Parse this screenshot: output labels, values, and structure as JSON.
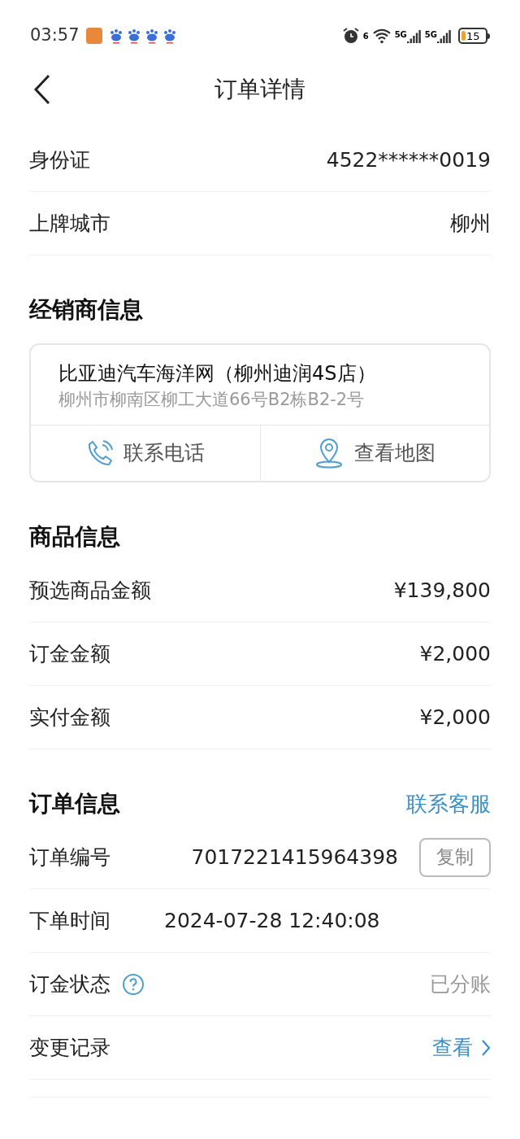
{
  "status_bar": {
    "time": "03:57",
    "wifi_label": "6",
    "signal_labels": [
      "5G",
      "5G"
    ],
    "battery": "15"
  },
  "header": {
    "title": "订单详情"
  },
  "top_rows": [
    {
      "label": "身份证",
      "value": "4522******0019"
    },
    {
      "label": "上牌城市",
      "value": "柳州"
    }
  ],
  "dealer": {
    "title": "经销商信息",
    "name": "比亚迪汽车海洋网（柳州迪润4S店）",
    "address": "柳州市柳南区柳工大道66号B2栋B2-2号",
    "actions": [
      {
        "kind": "phone",
        "label": "联系电话"
      },
      {
        "kind": "map",
        "label": "查看地图"
      }
    ]
  },
  "goods": {
    "title": "商品信息",
    "rows": [
      {
        "label": "预选商品金额",
        "value": "¥139,800"
      },
      {
        "label": "订金金额",
        "value": "¥2,000"
      },
      {
        "label": "实付金额",
        "value": "¥2,000"
      }
    ]
  },
  "order": {
    "title": "订单信息",
    "service_link": "联系客服",
    "rows": [
      {
        "kind": "copy",
        "label": "订单编号",
        "value": "7017221415964398",
        "button": "复制",
        "help": false
      },
      {
        "kind": "left",
        "label": "下单时间",
        "value": "2024-07-28 12:40:08",
        "help": false
      },
      {
        "kind": "muted",
        "label": "订金状态",
        "value": "已分账",
        "help": true
      },
      {
        "kind": "link",
        "label": "变更记录",
        "value": "查看",
        "help": false
      }
    ]
  }
}
